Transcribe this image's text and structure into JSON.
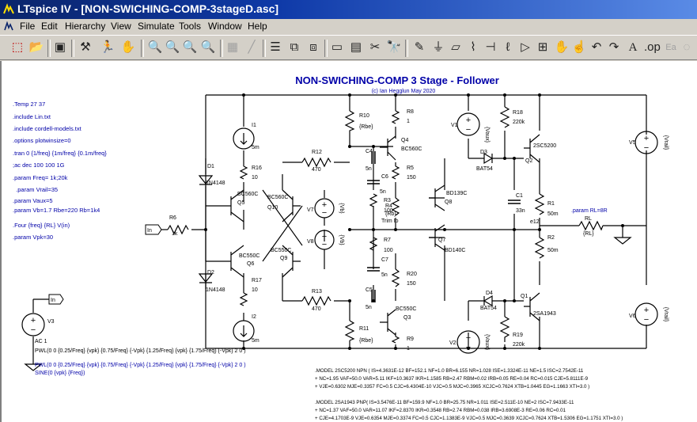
{
  "window": {
    "title": "LTspice IV - [NON-SWICHING-COMP-3stageD.asc]"
  },
  "menu": [
    "File",
    "Edit",
    "Hierarchy",
    "View",
    "Simulate",
    "Tools",
    "Window",
    "Help"
  ],
  "toolbar": {
    "icons": [
      "new-schematic",
      "open",
      "save",
      "control-panel",
      "run",
      "halt",
      "zoom-in",
      "pan",
      "zoom-out",
      "zoom-cancel",
      "autorange",
      "bode",
      "tile-horizontal",
      "tile-vertical",
      "close-window",
      "print",
      "find",
      "wire",
      "ground",
      "label",
      "resistor",
      "capacitor",
      "inductor",
      "diode",
      "component",
      "move",
      "drag",
      "undo",
      "redo",
      "text",
      "spice-directive"
    ]
  },
  "schematic": {
    "title": "NON-SWICHING-COMP 3 Stage - Follower",
    "subtitle": "(c) Ian Hegglun May 2020",
    "directives": [
      ".Temp 27 37",
      ".include Lin.txt",
      ".include cordell-models.txt",
      ".options plotwinsize=0",
      ".tran 0 {1/freq} {1m/freq} {0.1m/freq}",
      ";ac dec 100 100 1G",
      ".param Freq= 1k;20k",
      "  .param Vrail=35",
      ".param Vaux=5",
      ".param Vb=1.7 Rbe=220 Rb=1k4",
      ".Four {freq} {RL} V(in)",
      ".param Vpk=30"
    ],
    "source_v3": {
      "name": "V3",
      "ac": "AC 1",
      "pwl1": "PWL(0 0 {0.25/Freq} {vpk} {0.75/Freq} {-Vpk} {1.25/Freq} {vpk} {1.75/Freq} {-Vpk} 2 0 )",
      "pwl2": "PWL(0 0 {0.25/Freq} {vpk} {0.75/Freq} {-Vpk} {1.25/Freq} {vpk} {1.75/Freq} {-Vpk} 2 0 )",
      "sine": "SINE(0 {vpk} {Freq})"
    },
    "labels": {
      "in": "In",
      "trim": "Trim Io",
      "e12": "e12",
      "param_rl": ".param RL=8R"
    },
    "models": [
      ".MODEL 2SC5200 NPN ( IS=4.3631E-12 BF=152.1 NF=1.0 BR=6.155 NR=1.028 ISE=1.3324E-11 NE=1.5 ISC=2.7542E-11",
      "+ NC=1.95 VAF=50.0 VAR=5.11 IKF=10.3637 IKR=1.1585 RB=2.47 RBM=0.02 IRB=0.05 RE=0.04 RC=0.015 CJE=5.8111E-9",
      "+ VJE=0.6302 MJE=0.3357 FC=0.5 CJC=6.4304E-10 VJC=0.5 MJC=0.3965 XCJC=0.7624 XTB=1.0445 EG=1.1663 XTI=3.0 )",
      ".MODEL 2SA1943 PNP( IS=3.5476E-11 BF=159.9 NF=1.0 BR=25.75 NR=1.011 ISE=2.511E-10 NE=2 ISC=7.9433E-11",
      "+ NC=1.37 VAF=50.0 VAR=11.07 IKF=2.8370 IKR=0.3548 RB=2.74 RBM=0.038 IRB=3.6908E-3 RE=0.06 RC=0.01",
      "+ CJE=4.1703E-9 VJE=0.6354 MJE=0.3374 FC=0.5 CJC=1.1383E-9 VJC=0.5 MJC=0.3639 XCJC=0.7624 XTB=1.5306 EG=1.1751 XTI=3.0 )"
    ],
    "components": [
      {
        "ref": "I1",
        "value": "5m"
      },
      {
        "ref": "I2",
        "value": "5m"
      },
      {
        "ref": "R10",
        "value": "{Rbe}"
      },
      {
        "ref": "R8",
        "value": "1"
      },
      {
        "ref": "V1",
        "value": "{Vaux}"
      },
      {
        "ref": "R18",
        "value": "220k"
      },
      {
        "ref": "Q4",
        "value": "BC560C"
      },
      {
        "ref": "C4",
        "value": "5n"
      },
      {
        "ref": "D3",
        "value": "BAT54"
      },
      {
        "ref": "Q2",
        "value": "2SC5200"
      },
      {
        "ref": "V5",
        "value": "{Vrail}"
      },
      {
        "ref": "D1",
        "value": "1N4148"
      },
      {
        "ref": "R16",
        "value": "10"
      },
      {
        "ref": "R12",
        "value": "470"
      },
      {
        "ref": "R5",
        "value": "150"
      },
      {
        "ref": "C6",
        "value": "5n"
      },
      {
        "ref": "Q5",
        "value": "BC560C"
      },
      {
        "ref": "Q10",
        "value": "BC560C"
      },
      {
        "ref": "R3",
        "value": "100"
      },
      {
        "ref": "R4",
        "value": "{Rb}"
      },
      {
        "ref": "Q8",
        "value": "BD139C"
      },
      {
        "ref": "C1",
        "value": "33n"
      },
      {
        "ref": "R1",
        "value": "50m"
      },
      {
        "ref": "R6",
        "value": "1k"
      },
      {
        "ref": "V7",
        "value": "{Vb}"
      },
      {
        "ref": "V8",
        "value": "{Vb}"
      },
      {
        "ref": "R7",
        "value": "100"
      },
      {
        "ref": "Q7",
        "value": "BD140C"
      },
      {
        "ref": "RL",
        "value": "{RL}"
      },
      {
        "ref": "R2",
        "value": "50m"
      },
      {
        "ref": "Q6",
        "value": "BC550C"
      },
      {
        "ref": "Q9",
        "value": "BC550C"
      },
      {
        "ref": "C7",
        "value": "5n"
      },
      {
        "ref": "D2",
        "value": "1N4148"
      },
      {
        "ref": "R17",
        "value": "10"
      },
      {
        "ref": "R20",
        "value": "150"
      },
      {
        "ref": "R13",
        "value": "470"
      },
      {
        "ref": "C5",
        "value": "5n"
      },
      {
        "ref": "D4",
        "value": "BAT54"
      },
      {
        "ref": "Q1",
        "value": "2SA1943"
      },
      {
        "ref": "Q3",
        "value": "BC550C"
      },
      {
        "ref": "R11",
        "value": "{Rbe}"
      },
      {
        "ref": "R9",
        "value": "1"
      },
      {
        "ref": "V2",
        "value": "{Vaux}"
      },
      {
        "ref": "R19",
        "value": "220k"
      },
      {
        "ref": "V6",
        "value": "{Vrail}"
      }
    ]
  }
}
